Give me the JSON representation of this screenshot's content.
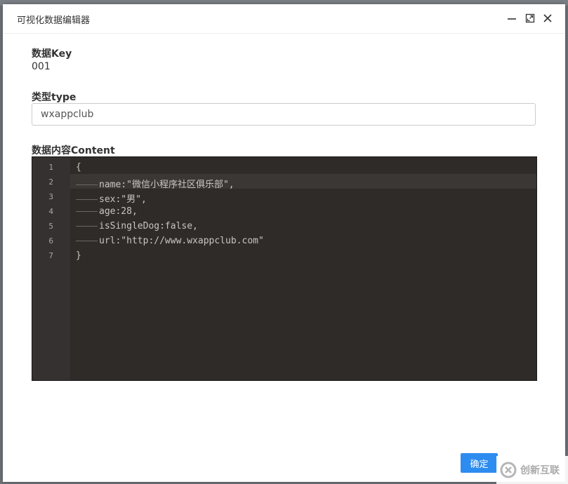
{
  "dialog": {
    "title": "可视化数据编辑器"
  },
  "fields": {
    "key_label": "数据Key",
    "key_value": "001",
    "type_label": "类型type",
    "type_value": "wxappclub",
    "content_label": "数据内容Content"
  },
  "editor": {
    "line_numbers": [
      "1",
      "2",
      "3",
      "4",
      "5",
      "6",
      "7"
    ],
    "lines": [
      "{",
      "name:\"微信小程序社区俱乐部\",",
      "sex:\"男\",",
      "age:28,",
      "isSingleDog:false,",
      "url:\"http://www.wxappclub.com\"",
      "}"
    ]
  },
  "footer": {
    "ok_label": "确定"
  },
  "watermark": {
    "text": "创新互联"
  },
  "colors": {
    "primary": "#2d8cf0",
    "editor_bg": "#2e2b29",
    "gutter_bg": "#343130"
  }
}
